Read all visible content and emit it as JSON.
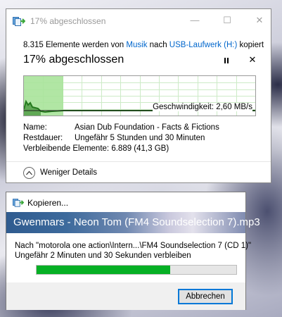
{
  "copy_window": {
    "title": "17% abgeschlossen",
    "title_buttons": {
      "minimize": "—",
      "maximize": "☐",
      "close": "✕"
    },
    "summary": {
      "prefix": "8.315 Elemente werden von",
      "source": "Musik",
      "middle": "nach",
      "destination": "USB-Laufwerk (H:)",
      "suffix": "kopiert"
    },
    "heading": "17% abgeschlossen",
    "pause_icon": "pause-icon",
    "close_symbol": "✕",
    "graph": {
      "progress": 0.17,
      "speed": "Geschwindigkeit: 2,60 MB/s",
      "fill_color": "#a8e39a",
      "line_color": "#257a1e"
    },
    "details": {
      "name_label": "Name:",
      "name_value": "Asian Dub Foundation - Facts & Fictions",
      "time_label": "Restdauer:",
      "time_value": "Ungefähr 5 Stunden und 30 Minuten",
      "items_label": "Verbleibende Elemente:",
      "items_value": "6.889 (41,3 GB)"
    },
    "less_details": "Weniger Details"
  },
  "file_window": {
    "title": "Kopieren...",
    "banner": "Gwenmars - Neon Tom (FM4 Soundselection 7).mp3",
    "destination": "Nach \"motorola one action\\Intern...\\FM4 Soundselection 7 (CD 1)\"",
    "remaining": "Ungefähr 2 Minuten und 30 Sekunden verbleiben",
    "progress": 0.67,
    "progress_color": "#06b025",
    "cancel": "Abbrechen"
  }
}
